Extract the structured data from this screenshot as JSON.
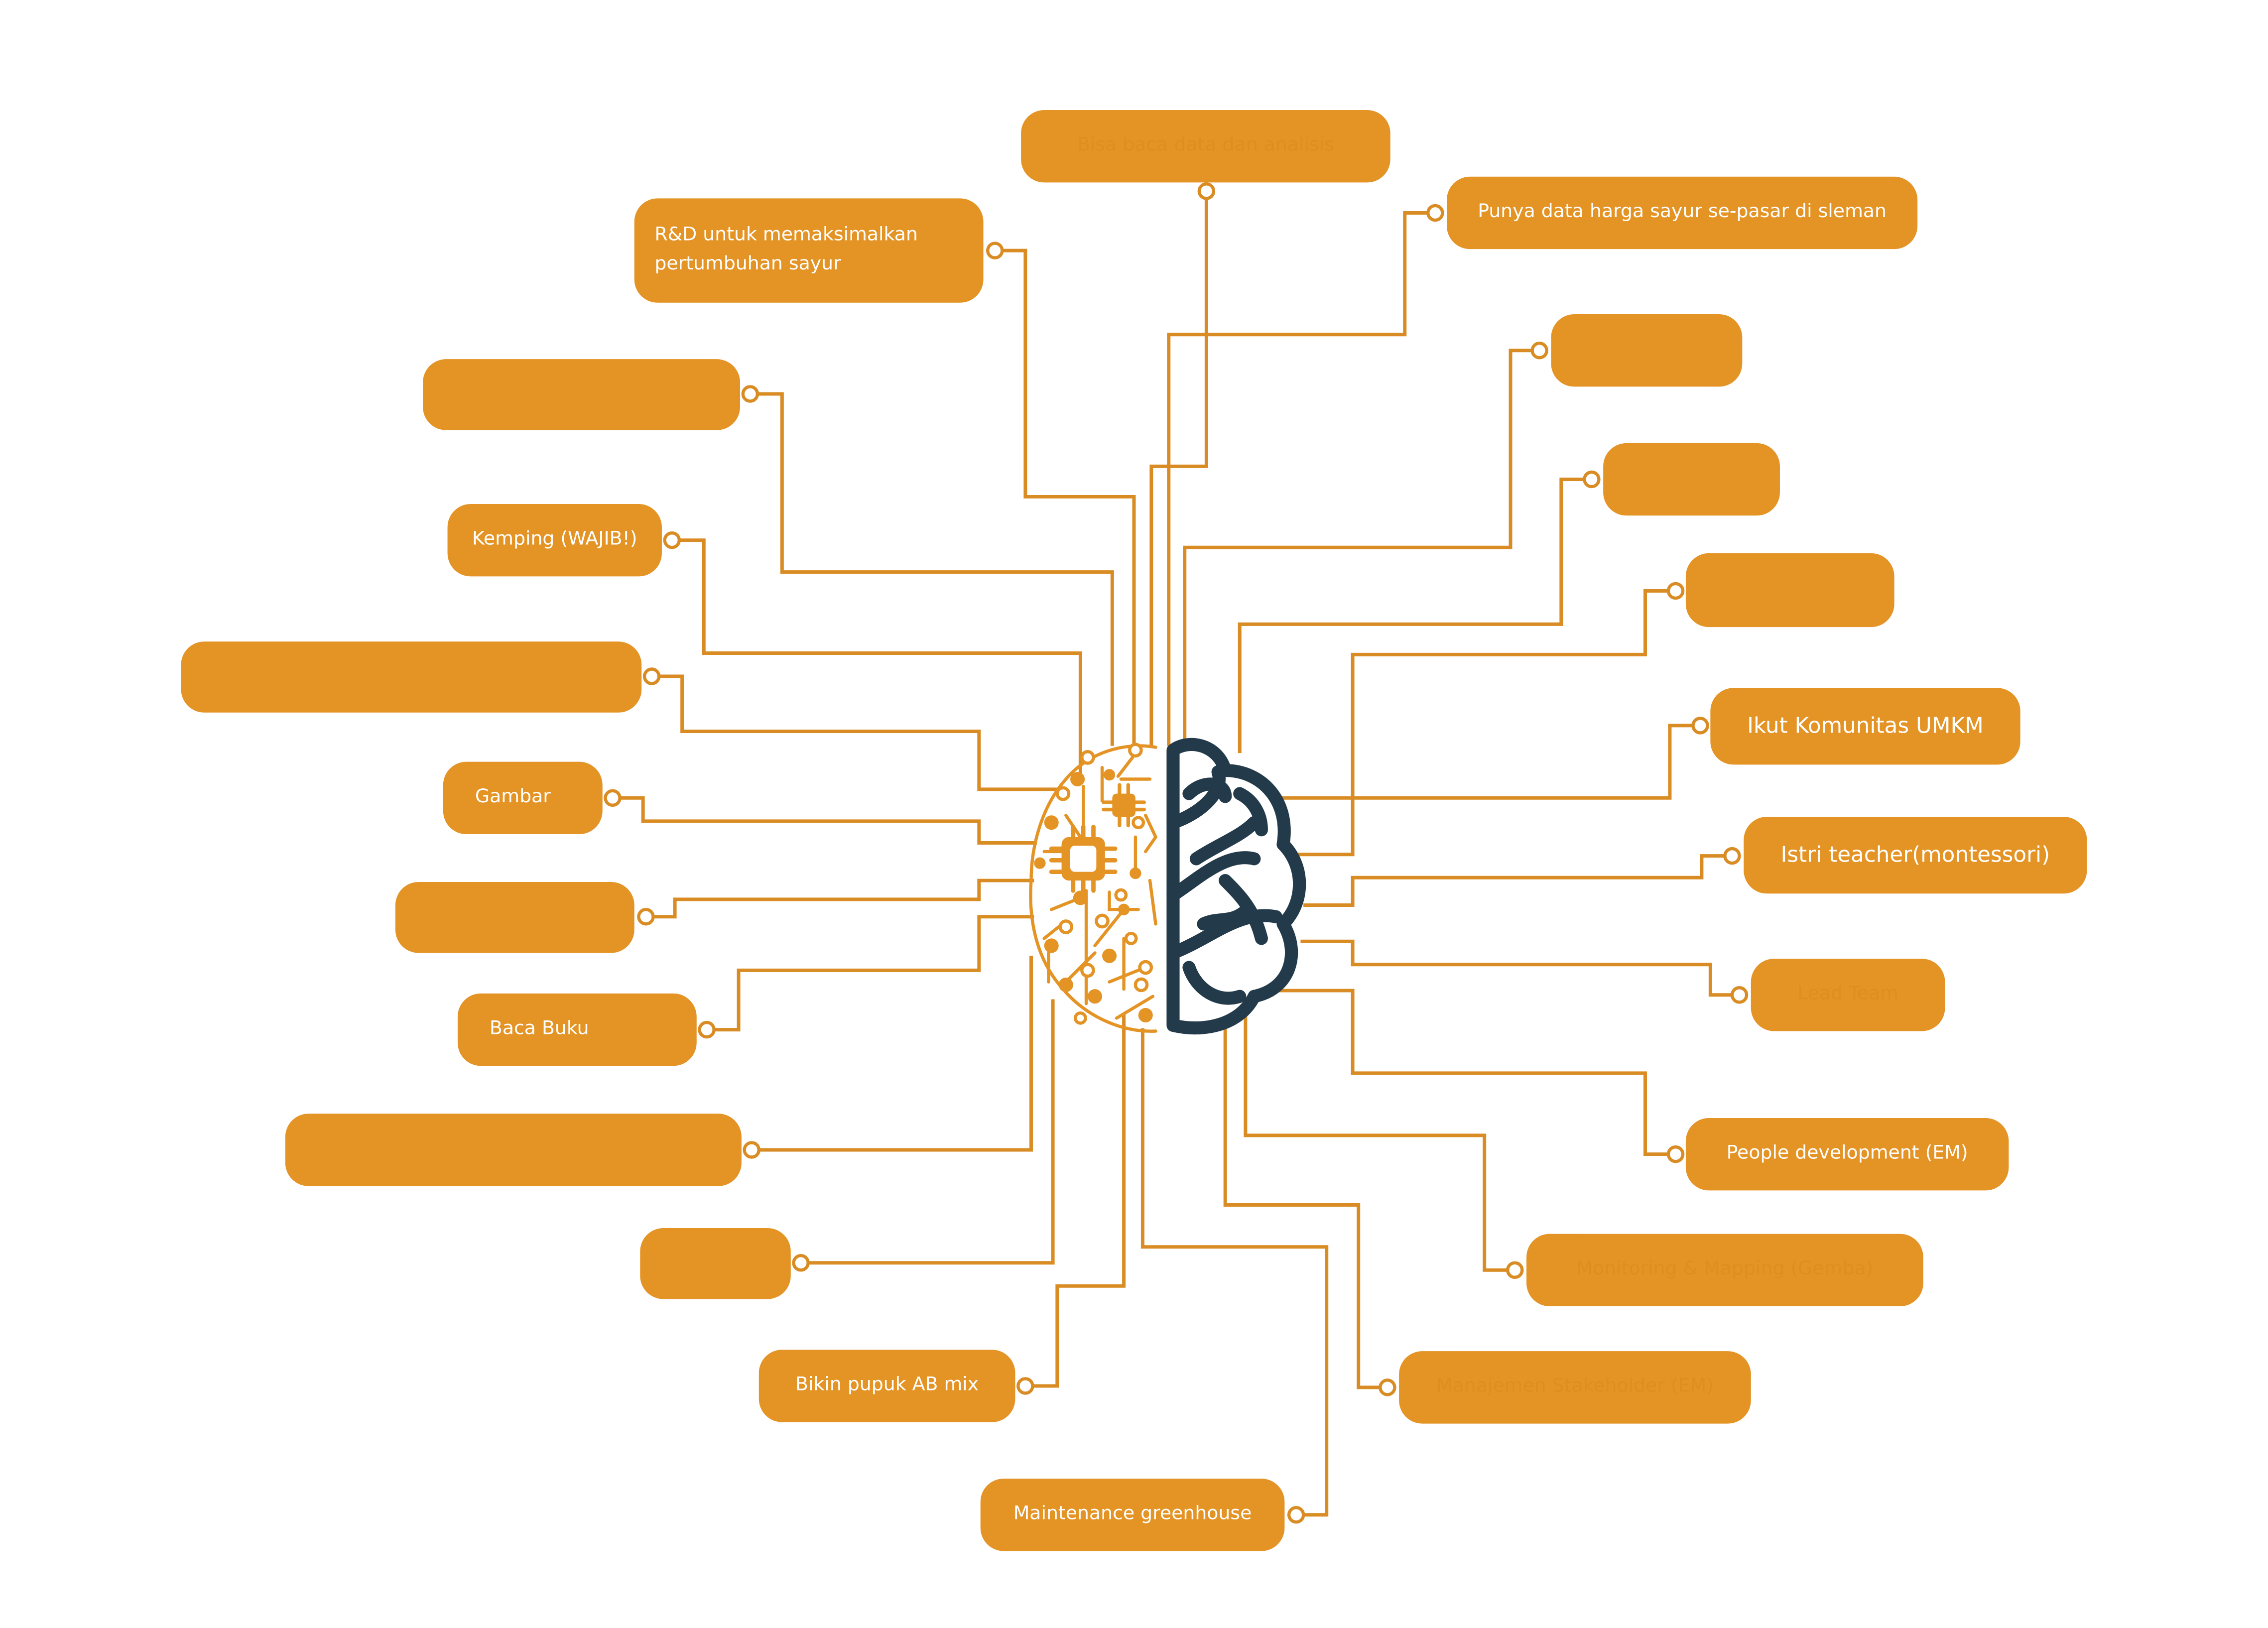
{
  "diagram": {
    "type": "mind-map",
    "colors": {
      "node_fill": "#e49325",
      "node_text": "#ffffff",
      "connector": "#d98c24",
      "brain_outline": "#233a4a",
      "background": "#ffffff"
    },
    "center_icon": "brain-circuit-icon",
    "nodes": [
      {
        "id": "top",
        "label": "Bisa baca data dan analisis",
        "hidden_text": true
      },
      {
        "id": "rnd",
        "label": "R&D untuk memaksimalkan\npertumbuhan sayur"
      },
      {
        "id": "harga",
        "label": "Punya data harga sayur se-pasar di sleman"
      },
      {
        "id": "left1",
        "label": ""
      },
      {
        "id": "kemping",
        "label": "Kemping (WAJIB!)"
      },
      {
        "id": "left2",
        "label": ""
      },
      {
        "id": "gambar",
        "label": "Gambar"
      },
      {
        "id": "left3",
        "label": ""
      },
      {
        "id": "bacabuku",
        "label": "Baca Buku"
      },
      {
        "id": "left4",
        "label": ""
      },
      {
        "id": "left5",
        "label": ""
      },
      {
        "id": "pupuk",
        "label": "Bikin pupuk AB mix"
      },
      {
        "id": "greenhouse",
        "label": "Maintenance greenhouse"
      },
      {
        "id": "right1",
        "label": ""
      },
      {
        "id": "right2",
        "label": ""
      },
      {
        "id": "right3",
        "label": ""
      },
      {
        "id": "umkm",
        "label": "Ikut Komunitas UMKM"
      },
      {
        "id": "istri",
        "label": "Istri teacher(montessori)"
      },
      {
        "id": "leadteam",
        "label": "Lead Team",
        "hidden_text": true
      },
      {
        "id": "people",
        "label": "People development (EM)"
      },
      {
        "id": "gemba",
        "label": "Monitoring & Mapping (Gemba)",
        "hidden_text": true
      },
      {
        "id": "stakeholder",
        "label": "Manajemen Stakeholder (EM)",
        "hidden_text": true
      }
    ]
  }
}
